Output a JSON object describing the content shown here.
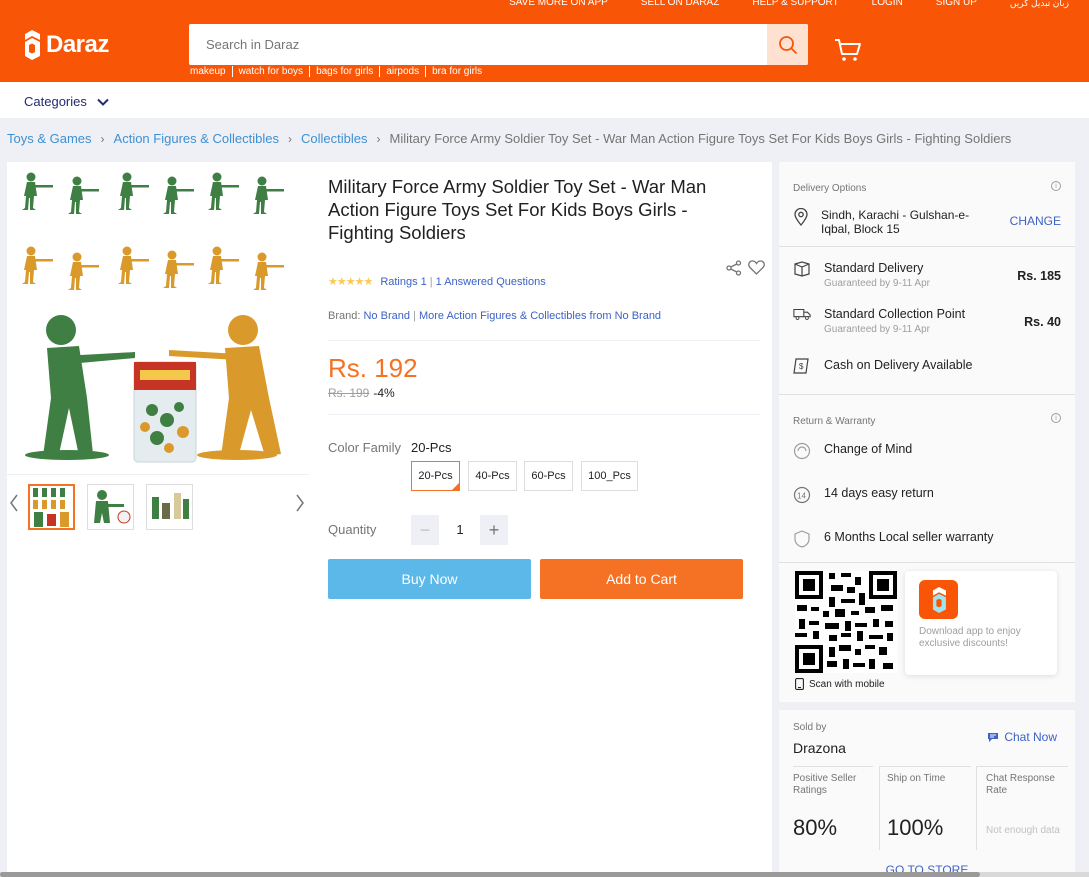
{
  "header": {
    "top_links": [
      "SAVE MORE ON APP",
      "SELL ON DARAZ",
      "HELP & SUPPORT",
      "LOGIN",
      "SIGN UP",
      "زبان تبدیل کریں"
    ],
    "logo_text": "Daraz",
    "search_placeholder": "Search in Daraz",
    "hot_words": [
      "makeup",
      "watch for boys",
      "bags for girls",
      "airpods",
      "bra for girls"
    ],
    "brand_color": "#f85606"
  },
  "categories_label": "Categories",
  "breadcrumb": [
    "Toys & Games",
    "Action Figures & Collectibles",
    "Collectibles",
    "Military Force Army Soldier Toy Set - War Man Action Figure Toys Set For Kids Boys Girls - Fighting Soldiers"
  ],
  "product": {
    "title": "Military Force Army Soldier Toy Set - War Man Action Figure Toys Set For Kids Boys Girls - Fighting Soldiers",
    "stars": "★★★★★",
    "ratings": "Ratings 1",
    "questions": "1 Answered Questions",
    "brand_label": "Brand:",
    "brand": "No Brand",
    "brand_more": "More Action Figures & Collectibles from No Brand",
    "price": "Rs. 192",
    "old_price": "Rs. 199",
    "discount": "-4%",
    "color_family_label": "Color Family",
    "color_family_value": "20-Pcs",
    "options": [
      "20-Pcs",
      "40-Pcs",
      "60-Pcs",
      "100_Pcs"
    ],
    "selected_option": "20-Pcs",
    "quantity_label": "Quantity",
    "quantity": "1",
    "buy_now": "Buy Now",
    "add_to_cart": "Add to Cart"
  },
  "delivery": {
    "heading": "Delivery Options",
    "location": "Sindh, Karachi - Gulshan-e-Iqbal, Block 15",
    "change": "CHANGE",
    "standard_title": "Standard Delivery",
    "standard_sub": "Guaranteed by 9-11 Apr",
    "standard_price": "Rs. 185",
    "collection_title": "Standard Collection Point",
    "collection_sub": "Guaranteed by 9-11 Apr",
    "collection_price": "Rs. 40",
    "cod": "Cash on Delivery Available"
  },
  "warranty": {
    "heading": "Return & Warranty",
    "change_of_mind": "Change of Mind",
    "return": "14 days easy return",
    "warranty": "6 Months Local seller warranty"
  },
  "app_promo": {
    "text": "Download app to enjoy exclusive discounts!",
    "scan": "Scan with mobile"
  },
  "seller": {
    "sold_by": "Sold by",
    "name": "Drazona",
    "chat": "Chat Now",
    "metrics": [
      {
        "label": "Positive Seller Ratings",
        "value": "80%"
      },
      {
        "label": "Ship on Time",
        "value": "100%"
      },
      {
        "label": "Chat Response Rate",
        "value": "Not enough data"
      }
    ],
    "go_to_store": "GO TO STORE"
  }
}
